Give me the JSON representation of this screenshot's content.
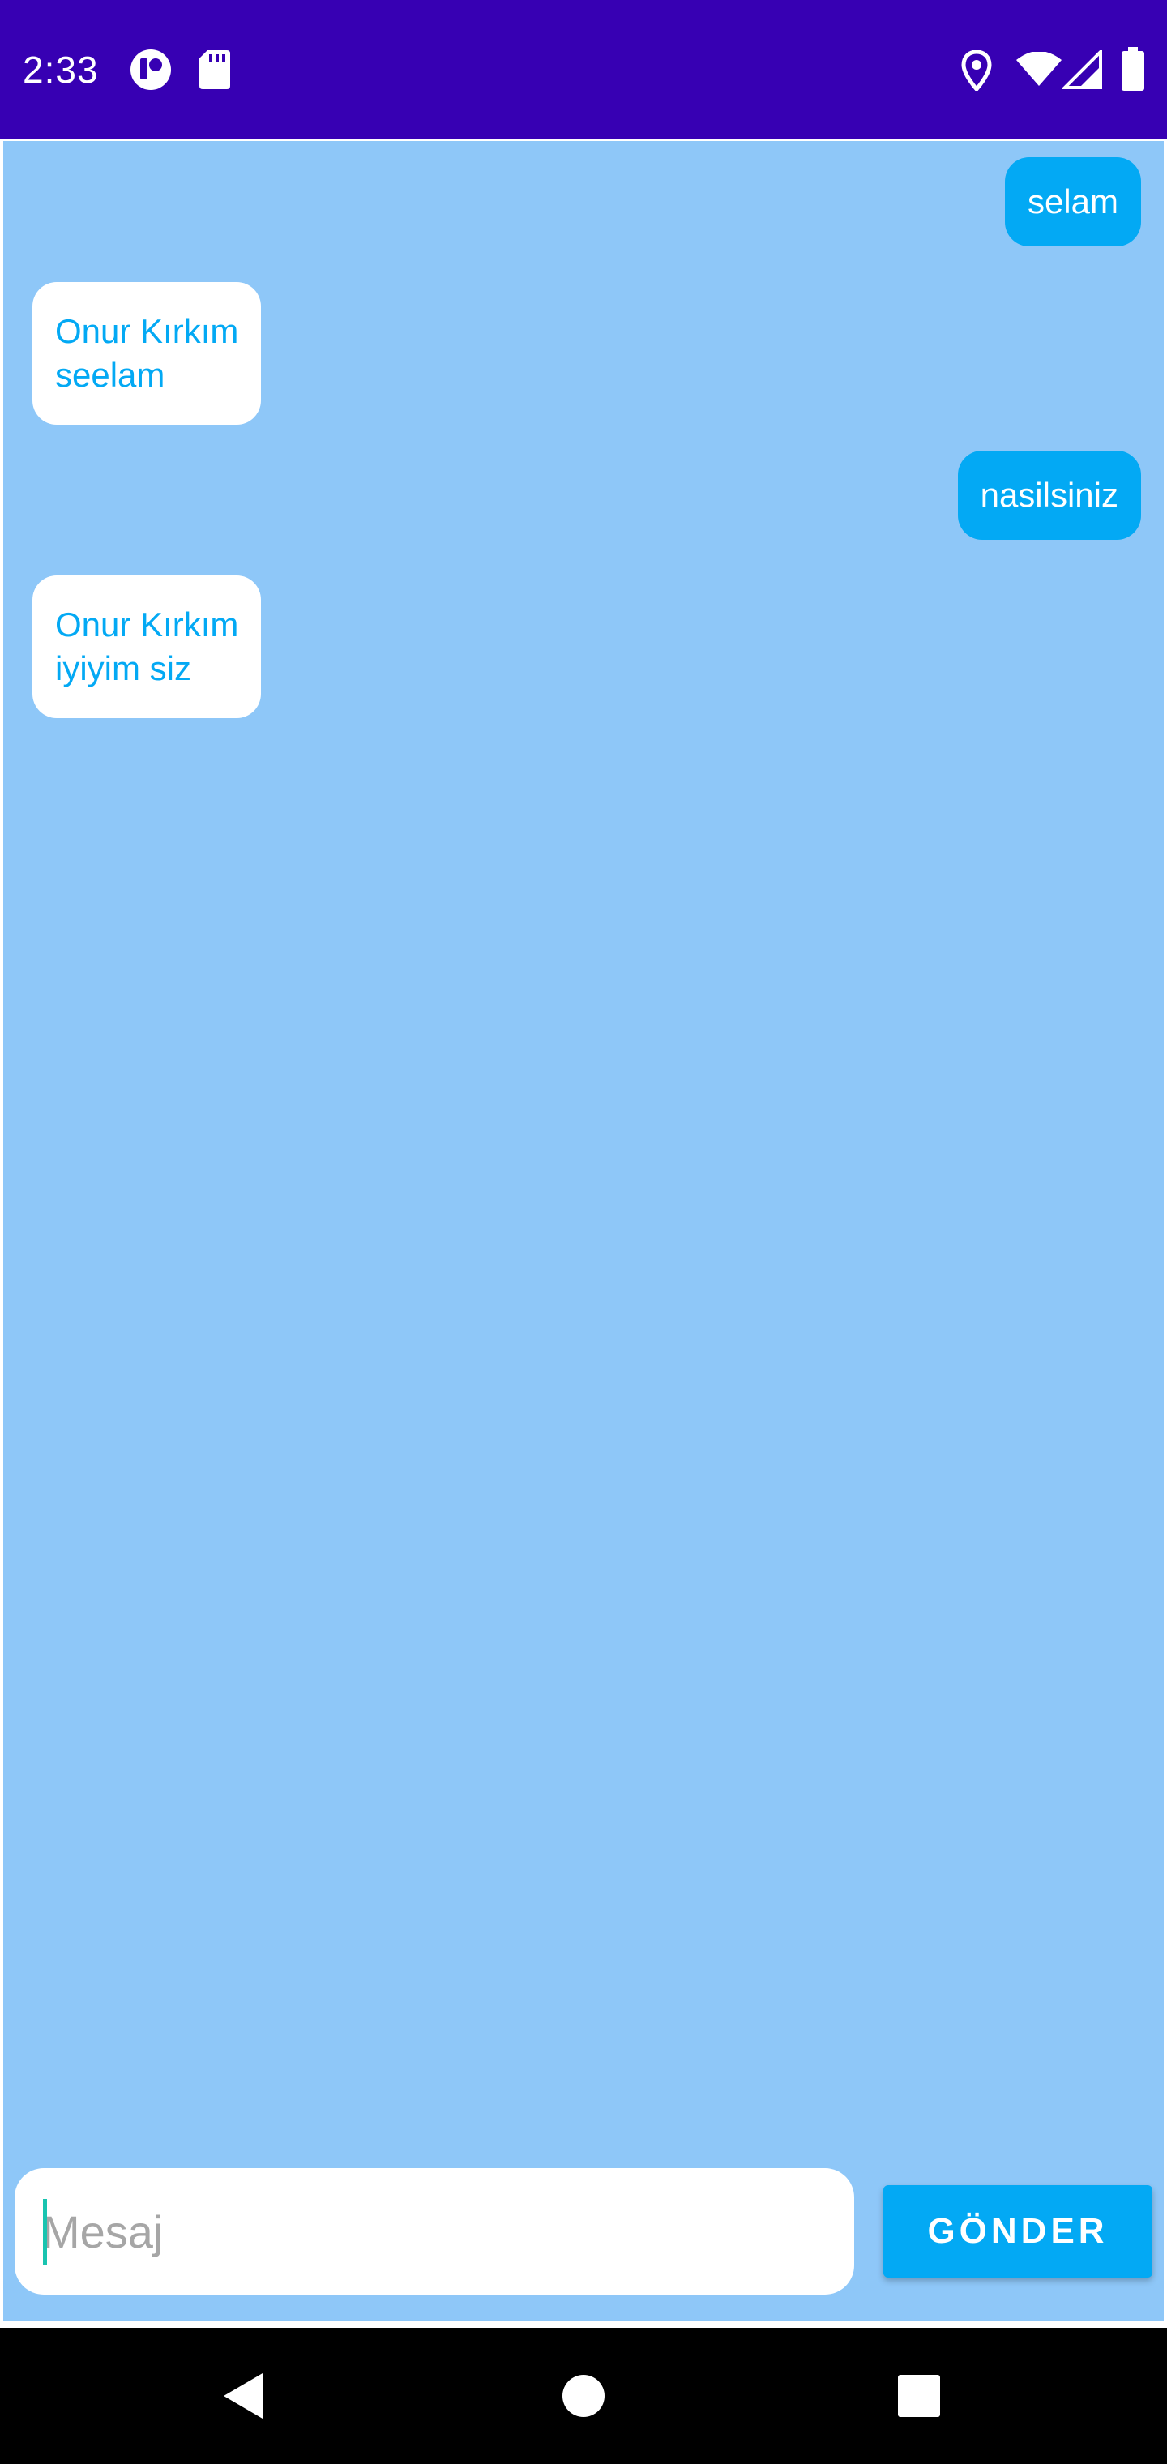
{
  "status_bar": {
    "time": "2:33",
    "left_icons": [
      "app-notification-icon",
      "sd-card-icon"
    ],
    "right_icons": [
      "location-icon",
      "wifi-icon",
      "cellular-signal-icon",
      "battery-icon"
    ],
    "background_color": "#3700b3"
  },
  "chat": {
    "background_color": "#8ec7f8",
    "messages": [
      {
        "direction": "sent",
        "text": "selam"
      },
      {
        "direction": "received",
        "text": "Onur Kırkım\nseelam"
      },
      {
        "direction": "sent",
        "text": "nasilsiniz"
      },
      {
        "direction": "received",
        "text": "Onur Kırkım\niyiyim siz"
      }
    ]
  },
  "composer": {
    "placeholder": "Mesaj",
    "value": "",
    "send_label": "GÖNDER",
    "accent_color": "#03a9f4"
  },
  "nav_bar": {
    "icons": [
      "back-icon",
      "home-icon",
      "recents-icon"
    ]
  }
}
